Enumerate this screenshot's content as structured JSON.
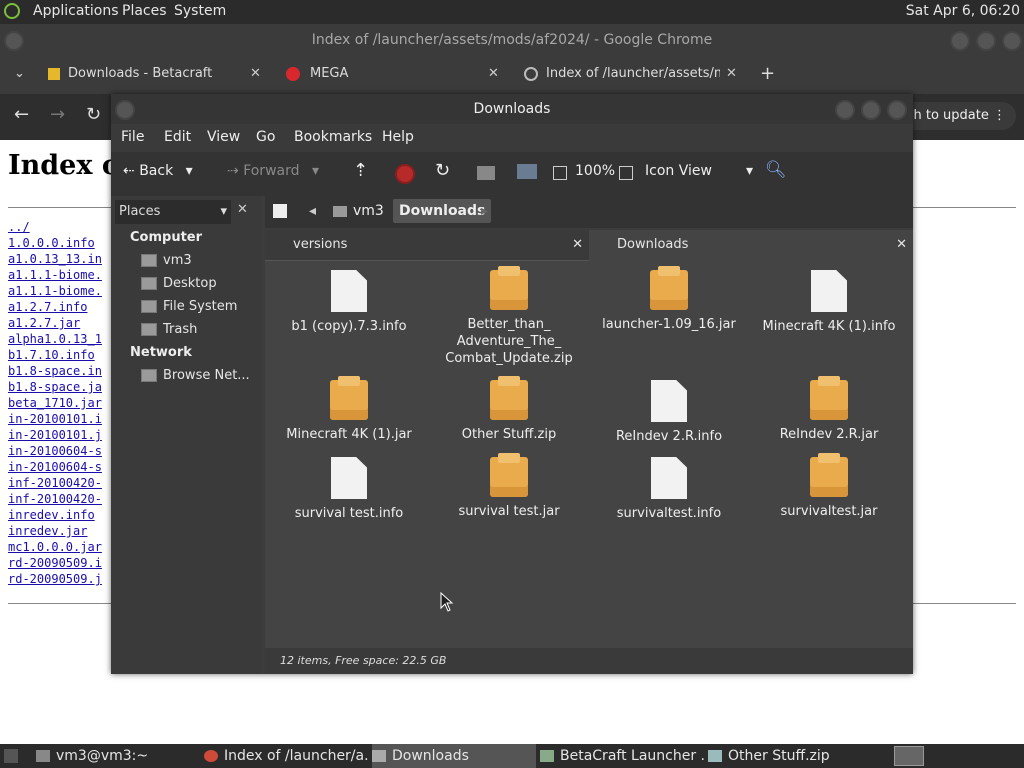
{
  "top_panel": {
    "menus": [
      "Applications",
      "Places",
      "System"
    ],
    "clock": "Sat Apr  6, 06:20"
  },
  "chrome": {
    "title": "Index of /launcher/assets/mods/af2024/ - Google Chrome",
    "tabs": [
      {
        "label": "Downloads - Betacraft"
      },
      {
        "label": "MEGA"
      },
      {
        "label": "Index of /launcher/assets/mo"
      }
    ],
    "new_tab": "+",
    "update_button": "nch to update"
  },
  "webpage": {
    "heading": "Index o",
    "links": [
      "../",
      "1.0.0.0.info",
      "a1.0.13_13.in",
      "a1.1.1-biome.",
      "a1.1.1-biome.",
      "a1.2.7.info",
      "a1.2.7.jar",
      "alpha1.0.13_1",
      "b1.7.10.info",
      "b1.8-space.in",
      "b1.8-space.ja",
      "beta_1710.jar",
      "in-20100101.i",
      "in-20100101.j",
      "in-20100604-s",
      "in-20100604-s",
      "inf-20100420-",
      "inf-20100420-",
      "inredev.info",
      "inredev.jar",
      "mc1.0.0.0.jar",
      "rd-20090509.i",
      "rd-20090509.j"
    ]
  },
  "file_manager": {
    "title": "Downloads",
    "menu": [
      "File",
      "Edit",
      "View",
      "Go",
      "Bookmarks",
      "Help"
    ],
    "toolbar": {
      "back": "Back",
      "forward": "Forward",
      "zoom": "100%",
      "view_mode": "Icon View"
    },
    "sidebar": {
      "combo": "Places",
      "sections": [
        {
          "heading": "Computer",
          "items": [
            "vm3",
            "Desktop",
            "File System",
            "Trash"
          ]
        },
        {
          "heading": "Network",
          "items": [
            "Browse Net..."
          ]
        }
      ]
    },
    "path": [
      "vm3",
      "Downloads"
    ],
    "content_tabs": [
      {
        "label": "versions"
      },
      {
        "label": "Downloads"
      }
    ],
    "files": [
      {
        "name": "b1 (copy).7.3.info",
        "type": "doc"
      },
      {
        "name": "Better_than_ Adventure_The_ Combat_Update.zip",
        "type": "zip"
      },
      {
        "name": "launcher-1.09_16.jar",
        "type": "zip"
      },
      {
        "name": "Minecraft 4K (1).info",
        "type": "doc"
      },
      {
        "name": "Minecraft 4K (1).jar",
        "type": "zip"
      },
      {
        "name": "Other Stuff.zip",
        "type": "zip"
      },
      {
        "name": "ReIndev 2.R.info",
        "type": "doc"
      },
      {
        "name": "ReIndev 2.R.jar",
        "type": "zip"
      },
      {
        "name": "survival test.info",
        "type": "doc"
      },
      {
        "name": "survival test.jar",
        "type": "zip"
      },
      {
        "name": "survivaltest.info",
        "type": "doc"
      },
      {
        "name": "survivaltest.jar",
        "type": "zip"
      }
    ],
    "status": "12 items, Free space: 22.5 GB"
  },
  "taskbar": {
    "items": [
      {
        "label": "vm3@vm3:~"
      },
      {
        "label": "Index of /launcher/a..."
      },
      {
        "label": "Downloads"
      },
      {
        "label": "BetaCraft Launcher ..."
      },
      {
        "label": "Other Stuff.zip"
      }
    ]
  },
  "colors": {
    "panel": "#2b2b2b",
    "window": "#3c3c3c",
    "link": "#1a0dab",
    "zip_icon": "#e9ab4b"
  }
}
